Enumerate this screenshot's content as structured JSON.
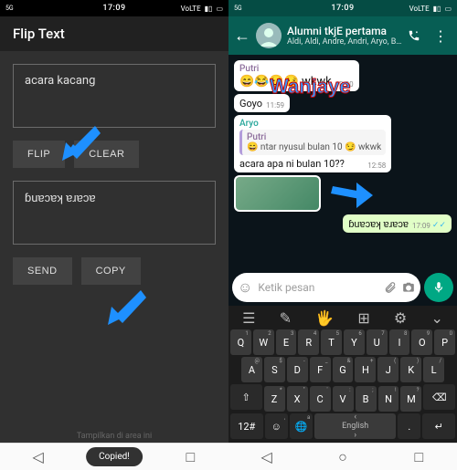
{
  "status": {
    "time": "17:09",
    "net_left": "5G",
    "net_right": "VoLTE"
  },
  "fliptext": {
    "appbar_title": "Flip Text",
    "input_text": "acara kacang",
    "output_text": "ɓuɐɔɐʞ ɐɹɐɔɐ",
    "btn_flip": "FLIP",
    "btn_clear": "CLEAR",
    "btn_send": "SEND",
    "btn_copy": "COPY",
    "toast": "Copied!",
    "ad_text": "Tampilkan di area ini"
  },
  "whatsapp": {
    "group_name": "Alumni tkjE pertama",
    "group_subtitle": "Aldi, Aldi, Andre, Andri, Aryo, Bonj...",
    "messages": [
      {
        "dir": "in",
        "sender": "Putri",
        "sender_color": "#8d6e9c",
        "text": "😄😂😏😏 wkwk",
        "time": "10:20"
      },
      {
        "dir": "in",
        "text": "Goyo",
        "time": "11:59"
      },
      {
        "dir": "in",
        "sender": "Aryo",
        "sender_color": "#26a69a",
        "quote": {
          "name": "Putri",
          "text": "😄 ntar nyusul bulan 10 😏 wkwk"
        },
        "text": "acara apa ni bulan 10??",
        "time": "12:58"
      },
      {
        "dir": "in",
        "type": "image"
      },
      {
        "dir": "out",
        "text": "ɓuɐɔɐʞ ɐɹɐɔɐ",
        "time": "17:09",
        "ticks": true
      }
    ],
    "input_placeholder": "Ketik pesan"
  },
  "watermark": "Wanjaye",
  "keyboard": {
    "row1": [
      {
        "k": "Q",
        "a": "1"
      },
      {
        "k": "W",
        "a": "2"
      },
      {
        "k": "E",
        "a": "3"
      },
      {
        "k": "R",
        "a": "4"
      },
      {
        "k": "T",
        "a": "5"
      },
      {
        "k": "Y",
        "a": "6"
      },
      {
        "k": "U",
        "a": "7"
      },
      {
        "k": "I",
        "a": "8"
      },
      {
        "k": "O",
        "a": "9"
      },
      {
        "k": "P",
        "a": "0"
      }
    ],
    "row2": [
      {
        "k": "A",
        "a": "@"
      },
      {
        "k": "S",
        "a": "$"
      },
      {
        "k": "D",
        "a": "-"
      },
      {
        "k": "F",
        "a": "_"
      },
      {
        "k": "G",
        "a": "&"
      },
      {
        "k": "H",
        "a": "+"
      },
      {
        "k": "J",
        "a": "("
      },
      {
        "k": "K",
        "a": ")"
      },
      {
        "k": "L",
        "a": "/"
      }
    ],
    "row3": [
      {
        "k": "Z",
        "a": "*"
      },
      {
        "k": "X",
        "a": "\""
      },
      {
        "k": "C",
        "a": "'"
      },
      {
        "k": "V",
        "a": ":"
      },
      {
        "k": "B",
        "a": ";"
      },
      {
        "k": "N",
        "a": "!"
      },
      {
        "k": "M",
        "a": "?"
      }
    ],
    "shift": "⇧",
    "back": "⌫",
    "sym": "12#",
    "comma": ",",
    "lang": "English",
    "period": ".",
    "enter": "↵",
    "smile_alt": "☺",
    "a_alt": "a"
  }
}
